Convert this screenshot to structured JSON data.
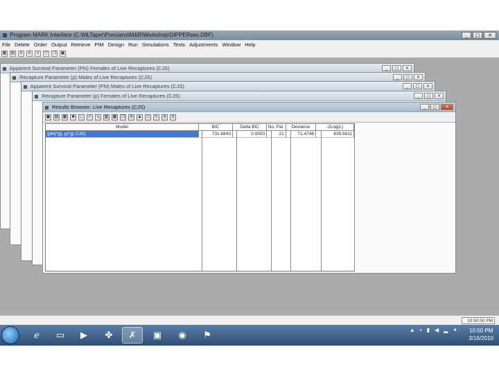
{
  "app": {
    "title": "Program MARK Interface  (C:\\MLTaper\\Poncians\\M&R\\Workshop\\DIPPERsex.DBF)"
  },
  "menu": [
    "File",
    "Delete",
    "Order",
    "Output",
    "Retrieve",
    "PIM",
    "Design",
    "Run",
    "Simulations",
    "Tests",
    "Adjustments",
    "Window",
    "Help"
  ],
  "child_windows": [
    "Apparent Survival Parameter (Phi) Females of Live Recaptures (CJS)",
    "Recapture Parameter (p) Males of Live Recaptures (CJS)",
    "Apparent Survival Parameter (Phi) Males of Live Recaptures (CJS)",
    "Recapture Parameter (p) Females of Live Recaptures (CJS)"
  ],
  "results_browser": {
    "title": "Results Browser: Live Recaptures (CJS)",
    "columns": [
      "Model",
      "BIC",
      "Delta BIC",
      "No. Par.",
      "Deviance",
      "-2Log(L)"
    ],
    "rows": [
      {
        "model": "{phi(*g), p(*g) CJS}",
        "bic": "731.6843",
        "delta_bic": "0.0000",
        "npar": "21",
        "deviance": "71.4748",
        "neg2logl": "639.5611"
      }
    ]
  },
  "status_bar": {
    "time": "10:50:50 PM"
  },
  "taskbar": {
    "time": "10:50 PM",
    "date": "3/16/2010"
  },
  "colors": {
    "selection": "#3a7bd5",
    "mdi_background": "#ababab"
  }
}
